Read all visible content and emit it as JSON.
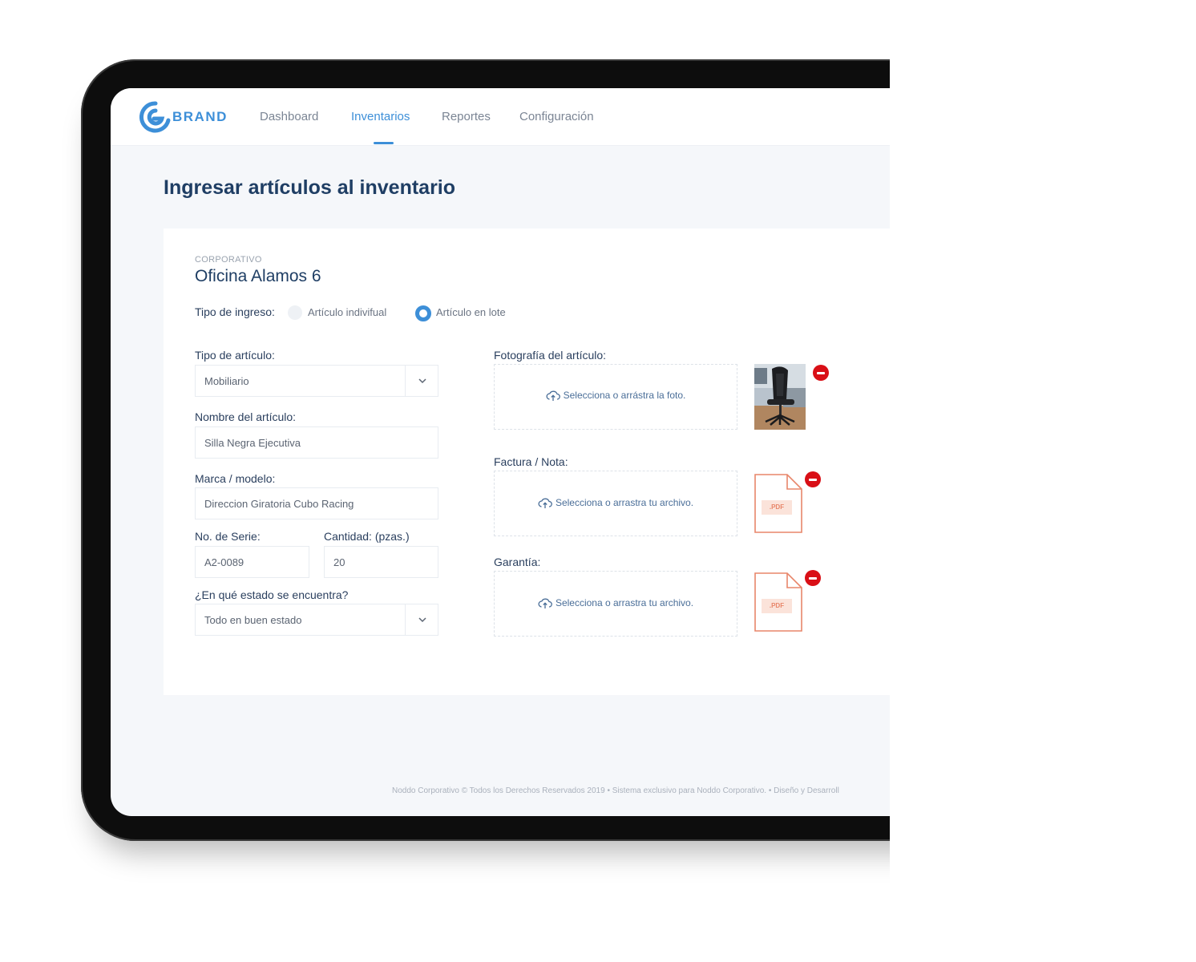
{
  "brand": {
    "name": "BRAND"
  },
  "nav": {
    "items": [
      {
        "label": "Dashboard",
        "active": false
      },
      {
        "label": "Inventarios",
        "active": true
      },
      {
        "label": "Reportes",
        "active": false
      },
      {
        "label": "Configuración",
        "active": false
      }
    ]
  },
  "page": {
    "title": "Ingresar artículos al inventario"
  },
  "location": {
    "category": "CORPORATIVO",
    "name": "Oficina Alamos 6"
  },
  "entry_type": {
    "label": "Tipo de ingreso:",
    "options": [
      {
        "label": "Artículo indivifual",
        "checked": false
      },
      {
        "label": "Artículo en lote",
        "checked": true
      }
    ]
  },
  "form": {
    "article_type": {
      "label": "Tipo de artículo:",
      "value": "Mobiliario"
    },
    "article_name": {
      "label": "Nombre del artículo:",
      "value": "Silla Negra Ejecutiva"
    },
    "brand_model": {
      "label": "Marca / modelo:",
      "value": "Direccion Giratoria Cubo Racing"
    },
    "serial": {
      "label": "No. de Serie:",
      "value": "A2-0089"
    },
    "quantity": {
      "label": "Cantidad: (pzas.)",
      "value": "20"
    },
    "condition": {
      "label": "¿En qué estado se encuentra?",
      "value": "Todo en buen estado"
    }
  },
  "uploads": {
    "photo": {
      "label": "Fotografía del artículo:",
      "prompt": "Selecciona o arrástra la foto."
    },
    "invoice": {
      "label": "Factura / Nota:",
      "prompt": "Selecciona o arrastra tu archivo.",
      "file_badge": ".PDF"
    },
    "warranty": {
      "label": "Garantía:",
      "prompt": "Selecciona o arrastra tu archivo.",
      "file_badge": ".PDF"
    }
  },
  "footer": {
    "text": "Noddo Corporativo © Todos los Derechos Reservados 2019 • Sistema exclusivo para Noddo Corporativo. • Diseño y Desarroll"
  },
  "colors": {
    "accent": "#3d8fd8",
    "title": "#1f3e64",
    "danger": "#d90f16",
    "pdf": "#e8866a"
  }
}
